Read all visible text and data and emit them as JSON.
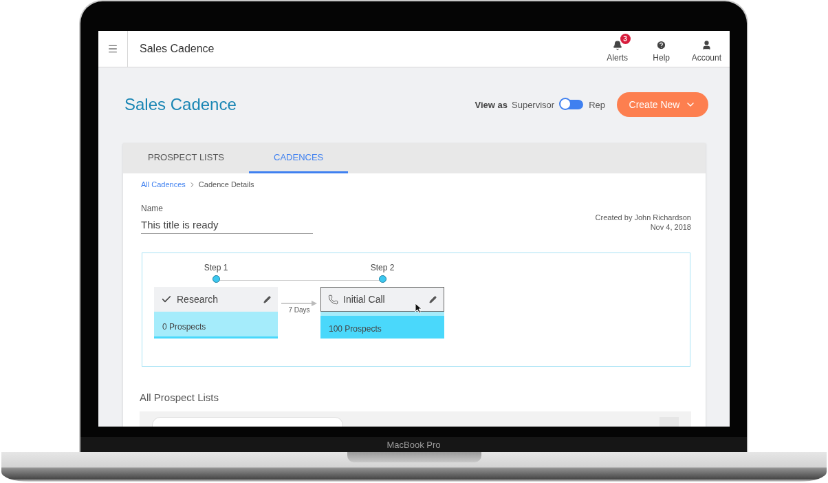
{
  "app": {
    "title": "Sales Cadence"
  },
  "nav": [
    {
      "kind": "alerts",
      "label": "Alerts",
      "badge": "3"
    },
    {
      "kind": "help",
      "label": "Help"
    },
    {
      "kind": "account",
      "label": "Account"
    }
  ],
  "page_title": "Sales Cadence",
  "view_as": {
    "label": "View as",
    "left": "Supervisor",
    "right": "Rep",
    "on": false
  },
  "create_button": "Create New",
  "tabs": [
    {
      "label": "PROSPECT LISTS",
      "selected": false
    },
    {
      "label": "CADENCES",
      "selected": true
    }
  ],
  "breadcrumb": [
    {
      "kind": "link",
      "label": "All Cadences"
    },
    {
      "kind": "current",
      "label": "Cadence Details"
    }
  ],
  "name_field": {
    "label": "Name",
    "value": "This title is ready"
  },
  "created": {
    "by": "Created by John Richardson",
    "date": "Nov 4, 2018"
  },
  "steps": [
    {
      "step": "Step 1",
      "kind": "research",
      "title": "Research",
      "prospects": "0 Prospects",
      "selected": false
    },
    {
      "step": "Step 2",
      "kind": "call",
      "title": "Initial Call",
      "prospects": "100 Prospects",
      "selected": true
    }
  ],
  "delay": "7 Days",
  "section_title": "All Prospect Lists",
  "device_label": "MacBook Pro"
}
